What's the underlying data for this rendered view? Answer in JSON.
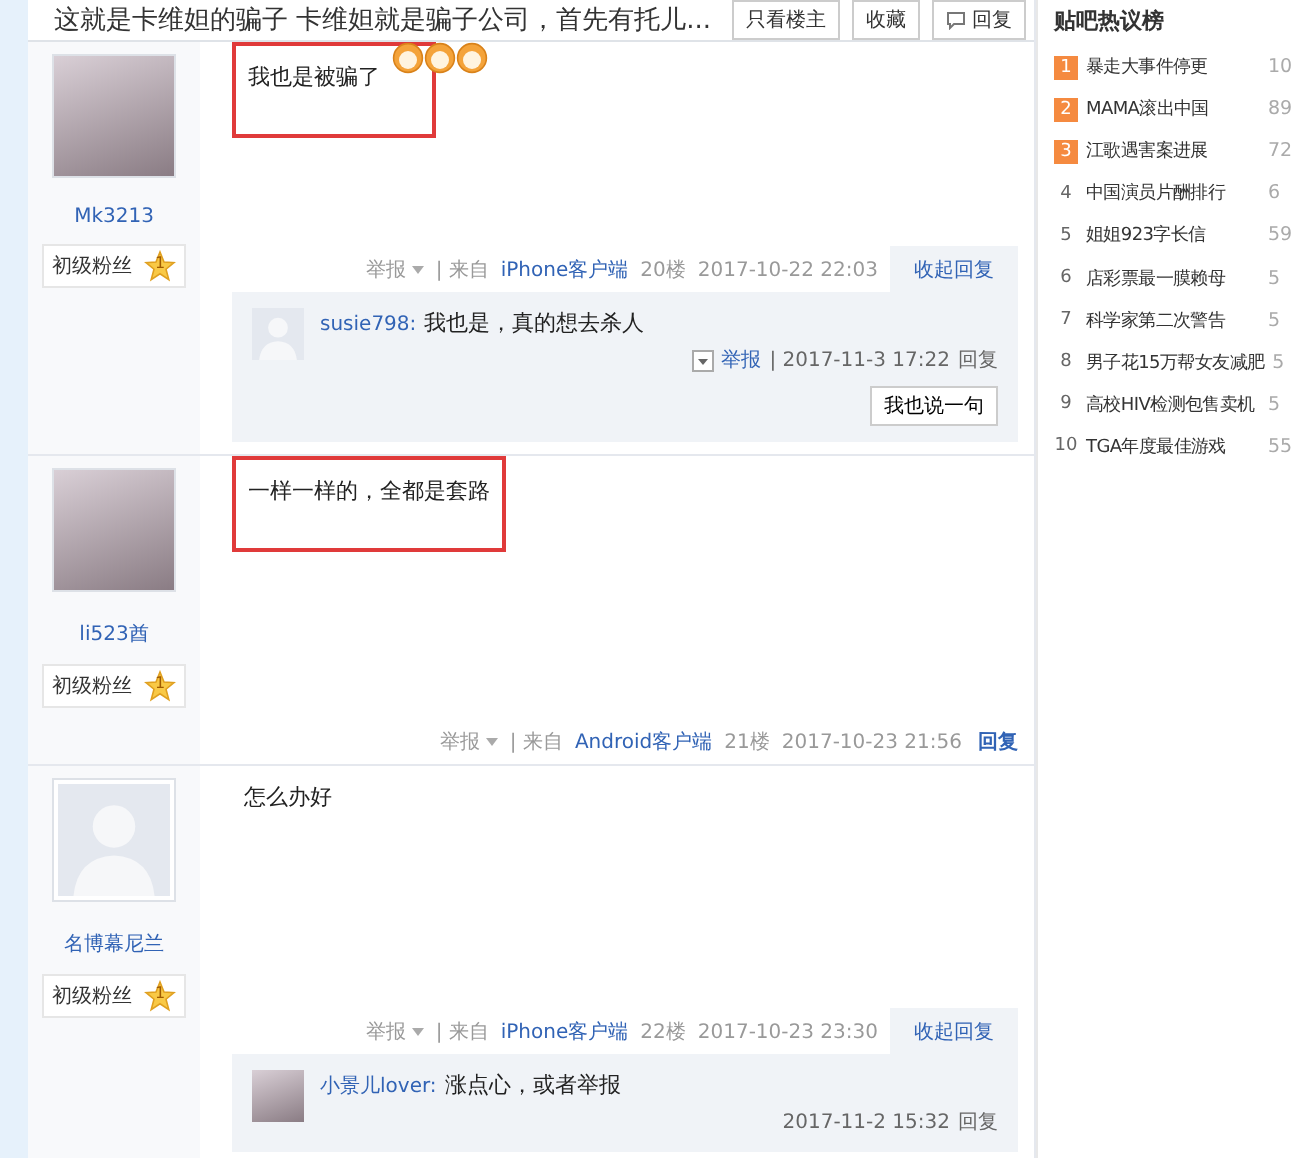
{
  "thread": {
    "title": "这就是卡维妲的骗子 卡维妲就是骗子公司，首先有托儿...",
    "buttons": [
      {
        "label": "只看楼主",
        "kind": "text"
      },
      {
        "label": "收藏",
        "kind": "text"
      },
      {
        "label": "回复",
        "kind": "reply"
      }
    ]
  },
  "posts": [
    {
      "author": "Mk3213",
      "avatar": {
        "kind": "photo"
      },
      "badge": "初级粉丝",
      "badge_level": "1",
      "text": "我也是被骗了",
      "highlighted": true,
      "emoticons": [
        {
          "kind": "smiley"
        },
        {
          "kind": "smiley"
        },
        {
          "kind": "smiley"
        }
      ],
      "report": "举报",
      "source": "| 来自",
      "client": "iPhone客户端",
      "floor": "20楼",
      "time": "2017-10-22 22:03",
      "reply_toggle": {
        "label": "收起回复",
        "expanded": true
      },
      "replies": [
        {
          "author": "susie798:",
          "avatar": {
            "kind": "generic"
          },
          "text": "我也是，真的想去杀人",
          "report": "举报",
          "time": "| 2017-11-3 17:22",
          "reply": "回复"
        }
      ],
      "reply_button": "我也说一句"
    },
    {
      "author": "li523酋",
      "avatar": {
        "kind": "photo"
      },
      "badge": "初级粉丝",
      "badge_level": "1",
      "text": "一样一样的，全都是套路",
      "highlighted": true,
      "report": "举报",
      "source": "| 来自",
      "client": "Android客户端",
      "floor": "21楼",
      "time": "2017-10-23 21:56",
      "reply_toggle": {
        "label": "回复",
        "expanded": false
      }
    },
    {
      "author": "名博幕尼兰",
      "avatar": {
        "kind": "generic"
      },
      "badge": "初级粉丝",
      "badge_level": "1",
      "text": "怎么办好",
      "highlighted": false,
      "report": "举报",
      "source": "| 来自",
      "client": "iPhone客户端",
      "floor": "22楼",
      "time": "2017-10-23 23:30",
      "reply_toggle": {
        "label": "收起回复",
        "expanded": true
      },
      "replies": [
        {
          "author": "小景儿lover:",
          "avatar": {
            "kind": "photo"
          },
          "text": "涨点心，或者举报",
          "time": "2017-11-2 15:32",
          "reply": "回复"
        }
      ]
    }
  ],
  "hot_list": {
    "title": "贴吧热议榜",
    "items": [
      {
        "rank": "1",
        "label": "暴走大事件停更",
        "count": "10",
        "highlighted": true
      },
      {
        "rank": "2",
        "label": "MAMA滚出中国",
        "count": "89",
        "highlighted": true
      },
      {
        "rank": "3",
        "label": "江歌遇害案进展",
        "count": "72",
        "highlighted": true
      },
      {
        "rank": "4",
        "label": "中国演员片酬排行",
        "count": "6",
        "highlighted": false
      },
      {
        "rank": "5",
        "label": "姐姐923字长信",
        "count": "59",
        "highlighted": false
      },
      {
        "rank": "6",
        "label": "店彩票最一膜赖母",
        "count": "5",
        "highlighted": false
      },
      {
        "rank": "7",
        "label": "科学家第二次警告",
        "count": "5",
        "highlighted": false
      },
      {
        "rank": "8",
        "label": "男子花15万帮女友减肥",
        "count": "5",
        "highlighted": false
      },
      {
        "rank": "9",
        "label": "高校HIV检测包售卖机",
        "count": "5",
        "highlighted": false
      },
      {
        "rank": "10",
        "label": "TGA年度最佳游戏",
        "count": "55",
        "highlighted": false
      }
    ]
  }
}
